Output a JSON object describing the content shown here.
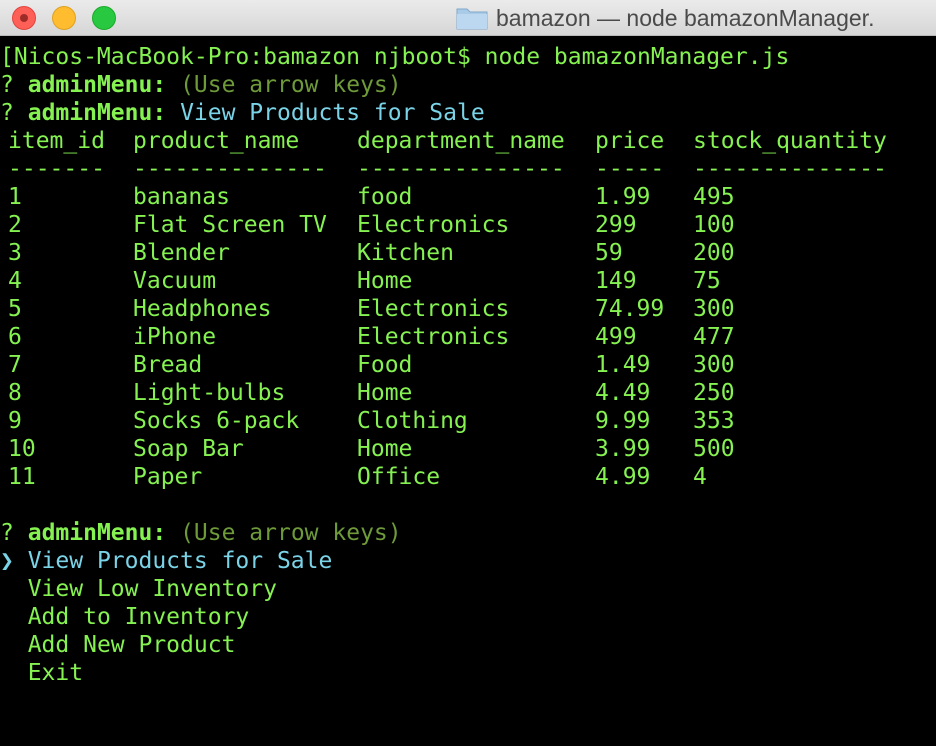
{
  "window": {
    "title": "bamazon — node bamazonManager.",
    "colors": {
      "close": "#fe5f57",
      "minimize": "#febc2e",
      "maximize": "#28c840"
    }
  },
  "terminal": {
    "command_line": "[Nicos-MacBook-Pro:bamazon njboot$ node bamazonManager.js",
    "prompt_marker": "?",
    "menu_name": "adminMenu:",
    "hint_text": "(Use arrow keys)",
    "answered_value": "View Products for Sale",
    "table": {
      "headers": [
        "item_id",
        "product_name",
        "department_name",
        "price",
        "stock_quantity"
      ],
      "separators": [
        "-------",
        "--------------",
        "---------------",
        "-----",
        "--------------"
      ],
      "rows": [
        [
          "1",
          "bananas",
          "food",
          "1.99",
          "495"
        ],
        [
          "2",
          "Flat Screen TV",
          "Electronics",
          "299",
          "100"
        ],
        [
          "3",
          "Blender",
          "Kitchen",
          "59",
          "200"
        ],
        [
          "4",
          "Vacuum",
          "Home",
          "149",
          "75"
        ],
        [
          "5",
          "Headphones",
          "Electronics",
          "74.99",
          "300"
        ],
        [
          "6",
          "iPhone",
          "Electronics",
          "499",
          "477"
        ],
        [
          "7",
          "Bread",
          "Food",
          "1.49",
          "300"
        ],
        [
          "8",
          "Light-bulbs",
          "Home",
          "4.49",
          "250"
        ],
        [
          "9",
          "Socks 6-pack",
          "Clothing",
          "9.99",
          "353"
        ],
        [
          "10",
          "Soap Bar",
          "Home",
          "3.99",
          "500"
        ],
        [
          "11",
          "Paper",
          "Office",
          "4.99",
          "4"
        ]
      ]
    },
    "pointer_glyph": "❯",
    "menu_options": [
      "View Products for Sale",
      "View Low Inventory",
      "Add to Inventory",
      "Add New Product",
      "Exit"
    ],
    "selected_index": 0,
    "colors": {
      "text": "#85f252",
      "answer": "#7ad3e6",
      "hint": "#6e9a3a",
      "background": "#000000"
    }
  }
}
